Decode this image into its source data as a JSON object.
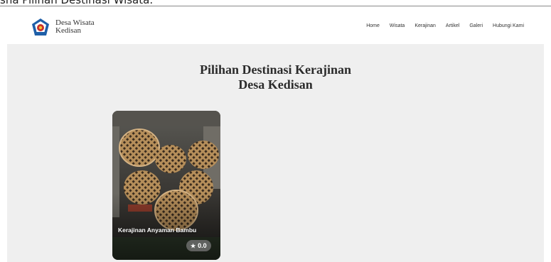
{
  "caption": "sna Pilihan Destinasi Wisata.",
  "brand": {
    "line1": "Desa Wisata",
    "line2": "Kedisan"
  },
  "nav": [
    "Home",
    "Wisata",
    "Kerajinan",
    "Artikel",
    "Galeri",
    "Hubungi Kami"
  ],
  "main": {
    "title_line1": "Pilihan Destinasi Kerajinan",
    "title_line2": "Desa Kedisan"
  },
  "cards": [
    {
      "title": "Kerajinan Anyaman Bambu",
      "rating": "0.0"
    }
  ],
  "colors": {
    "background": "#efefef",
    "navbar": "#ffffff",
    "text": "#2b2b2b",
    "card_text": "#ffffff",
    "logo_blue": "#1f5fa8",
    "logo_red": "#c9302c"
  },
  "icons": {
    "logo": "village-emblem-icon",
    "rating": "star-icon"
  }
}
